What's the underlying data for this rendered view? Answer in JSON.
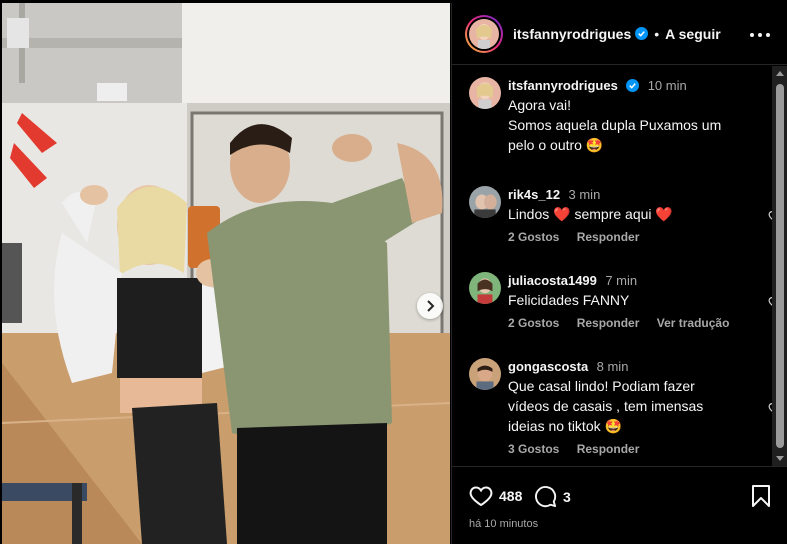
{
  "header": {
    "username": "itsfannyrodrigues",
    "separator": "•",
    "follow_label": "A seguir"
  },
  "caption": {
    "username": "itsfannyrodrigues",
    "time": "10 min",
    "line1": "Agora vai!",
    "line2": "Somos aquela dupla  Puxamos um",
    "line3": "pelo o outro 🤩"
  },
  "comments": [
    {
      "username": "rik4s_12",
      "time": "3 min",
      "text_lines": [
        "Lindos ❤️ sempre aqui ❤️"
      ],
      "likes": "2 Gostos",
      "reply": "Responder",
      "translate": ""
    },
    {
      "username": "juliacosta1499",
      "time": "7 min",
      "text_lines": [
        "Felicidades FANNY"
      ],
      "likes": "2 Gostos",
      "reply": "Responder",
      "translate": "Ver tradução"
    },
    {
      "username": "gongascosta",
      "time": "8 min",
      "text_lines": [
        "Que casal lindo! Podiam fazer",
        "vídeos de casais , tem imensas",
        "ideias no tiktok 🤩"
      ],
      "likes": "3 Gostos",
      "reply": "Responder",
      "translate": ""
    }
  ],
  "actions": {
    "likes_count": "488",
    "comments_count": "3",
    "posted": "há 10 minutos"
  },
  "icons": {
    "verified": "verified-badge-icon",
    "more": "more-options-icon",
    "like": "heart-icon",
    "comment": "comment-icon",
    "save": "bookmark-icon",
    "next": "chevron-right-icon"
  },
  "colors": {
    "background": "#000000",
    "text": "#f5f5f5",
    "muted": "#a8a8a8",
    "verified": "#0095f6",
    "heart_red": "#ed1c3e"
  }
}
